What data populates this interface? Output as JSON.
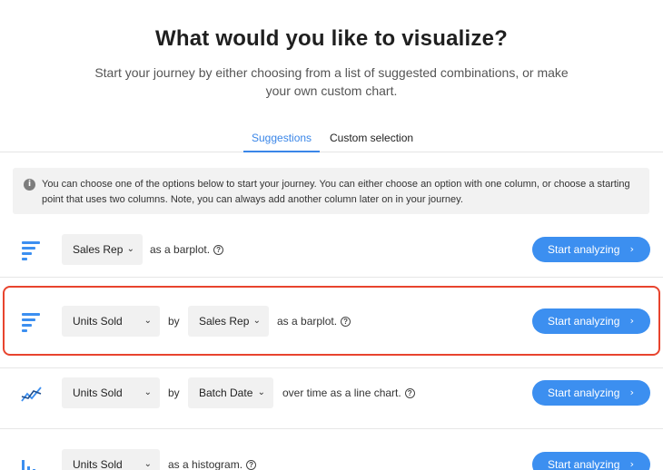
{
  "header": {
    "title": "What would you like to visualize?",
    "subtitle": "Start your journey by either choosing from a list of suggested combinations, or make your own custom chart."
  },
  "tabs": [
    {
      "label": "Suggestions",
      "active": true
    },
    {
      "label": "Custom selection",
      "active": false
    }
  ],
  "info": {
    "icon": "info-icon",
    "text": "You can choose one of the options below to start your journey. You can either choose an option with one column, or choose a starting point that uses two columns. Note, you can always add another column later on in your journey."
  },
  "suggestions": [
    {
      "icon": "barplot-icon",
      "column1": "Sales Rep",
      "by": "",
      "column2": "",
      "suffix": "as a barplot.",
      "button": "Start analyzing"
    },
    {
      "icon": "barplot-icon",
      "column1": "Units Sold",
      "by": "by",
      "column2": "Sales Rep",
      "suffix": "as a barplot.",
      "button": "Start analyzing"
    },
    {
      "icon": "line-chart-icon",
      "column1": "Units Sold",
      "by": "by",
      "column2": "Batch Date",
      "suffix": "over time as a line chart.",
      "button": "Start analyzing"
    },
    {
      "icon": "histogram-icon",
      "column1": "Units Sold",
      "by": "",
      "column2": "",
      "suffix": "as a histogram.",
      "button": "Start analyzing"
    }
  ],
  "colors": {
    "accent": "#3c8ff0",
    "highlight": "#e8442e"
  }
}
